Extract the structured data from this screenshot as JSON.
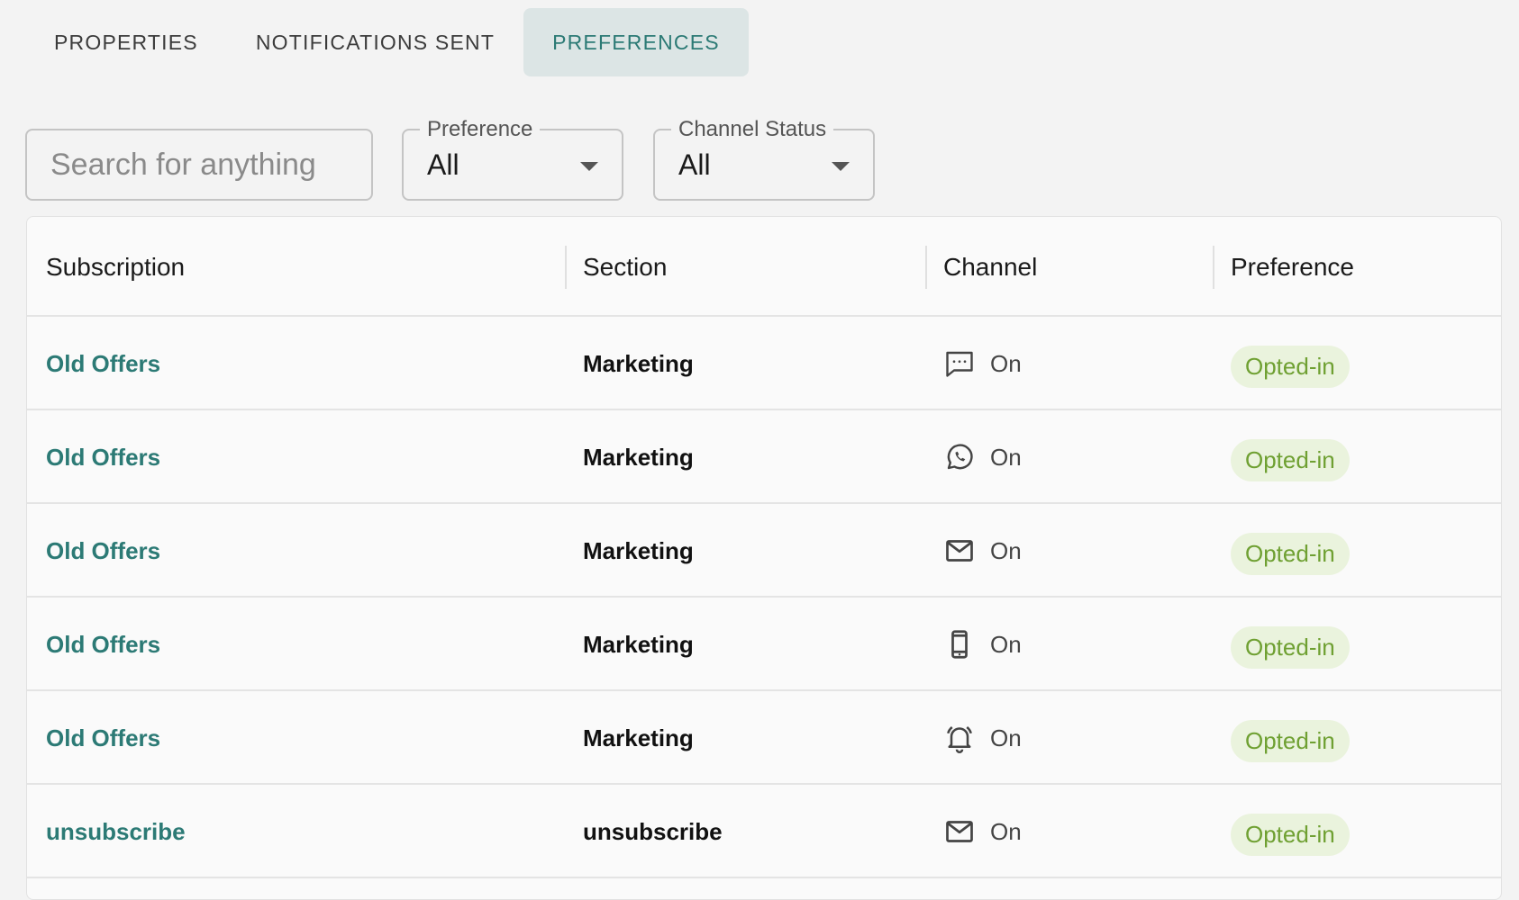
{
  "tabs": [
    {
      "label": "PROPERTIES"
    },
    {
      "label": "NOTIFICATIONS SENT"
    },
    {
      "label": "PREFERENCES"
    }
  ],
  "filters": {
    "search_placeholder": "Search for anything",
    "preference": {
      "label": "Preference",
      "value": "All"
    },
    "channel_status": {
      "label": "Channel Status",
      "value": "All"
    }
  },
  "table": {
    "headers": [
      "Subscription",
      "Section",
      "Channel",
      "Preference"
    ],
    "rows": [
      {
        "subscription": "Old Offers",
        "section": "Marketing",
        "channel_icon": "sms-icon",
        "channel_status": "On",
        "preference": "Opted-in"
      },
      {
        "subscription": "Old Offers",
        "section": "Marketing",
        "channel_icon": "whatsapp-icon",
        "channel_status": "On",
        "preference": "Opted-in"
      },
      {
        "subscription": "Old Offers",
        "section": "Marketing",
        "channel_icon": "email-icon",
        "channel_status": "On",
        "preference": "Opted-in"
      },
      {
        "subscription": "Old Offers",
        "section": "Marketing",
        "channel_icon": "mobile-push-icon",
        "channel_status": "On",
        "preference": "Opted-in"
      },
      {
        "subscription": "Old Offers",
        "section": "Marketing",
        "channel_icon": "bell-icon",
        "channel_status": "On",
        "preference": "Opted-in"
      },
      {
        "subscription": "unsubscribe",
        "section": "unsubscribe",
        "channel_icon": "email-icon",
        "channel_status": "On",
        "preference": "Opted-in"
      }
    ]
  },
  "colors": {
    "accent": "#2c7a75",
    "active_tab_bg": "#dce5e5",
    "pill_bg": "#eaf3dd",
    "pill_text": "#6fa032"
  }
}
